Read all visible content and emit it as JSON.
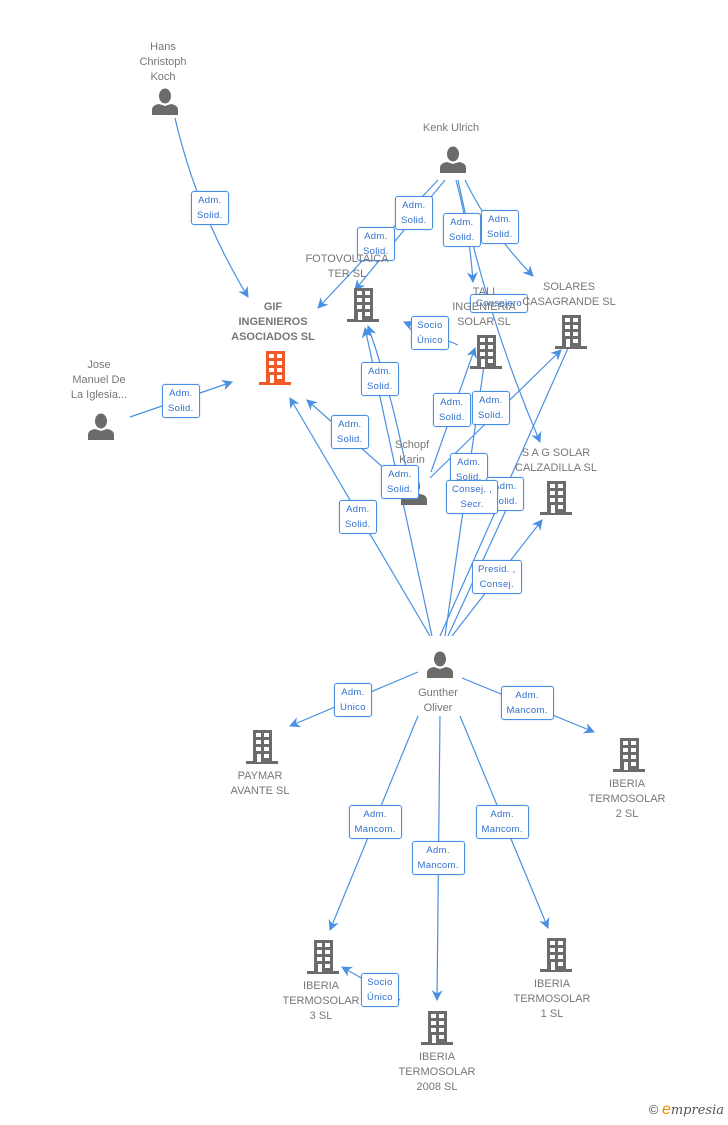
{
  "colors": {
    "edge": "#4a90e2",
    "edge_label_text": "#2f6fcf",
    "icon": "#6b6b6b",
    "focus_icon": "#f05a28",
    "node_text": "#777777"
  },
  "nodes": [
    {
      "id": "hans",
      "type": "person",
      "label": "Hans\nChristoph\nKoch",
      "icon": "person-icon"
    },
    {
      "id": "kenk",
      "type": "person",
      "label": "Kenk Ulrich",
      "icon": "person-icon"
    },
    {
      "id": "gif",
      "type": "company",
      "label": "GIF\nINGENIEROS\nASOCIADOS SL",
      "focus": true,
      "icon": "building-icon"
    },
    {
      "id": "jose",
      "type": "person",
      "label": "Jose\nManuel De\nLa Iglesia...",
      "icon": "person-icon"
    },
    {
      "id": "fotov",
      "type": "company",
      "label": "FOTOVOLTAICA\nTER SL",
      "icon": "building-icon"
    },
    {
      "id": "tali",
      "type": "company",
      "label": "TALI\nINGENIERIA\nSOLAR SL",
      "icon": "building-icon"
    },
    {
      "id": "solares",
      "type": "company",
      "label": "SOLARES\nCASAGRANDE SL",
      "icon": "building-icon"
    },
    {
      "id": "schopf",
      "type": "person",
      "label": "Schopf\nKarin",
      "icon": "person-icon"
    },
    {
      "id": "sag",
      "type": "company",
      "label": "S A G SOLAR\nCALZADILLA  SL",
      "icon": "building-icon"
    },
    {
      "id": "gunther",
      "type": "person",
      "label": "Gunther\nOliver",
      "icon": "person-icon"
    },
    {
      "id": "paymar",
      "type": "company",
      "label": "PAYMAR\nAVANTE SL",
      "icon": "building-icon"
    },
    {
      "id": "iberia2",
      "type": "company",
      "label": "IBERIA\nTERMOSOLAR\n2 SL",
      "icon": "building-icon"
    },
    {
      "id": "iberia3",
      "type": "company",
      "label": "IBERIA\nTERMOSOLAR\n3 SL",
      "icon": "building-icon"
    },
    {
      "id": "iberia2008",
      "type": "company",
      "label": "IBERIA\nTERMOSOLAR\n2008 SL",
      "icon": "building-icon"
    },
    {
      "id": "iberia1",
      "type": "company",
      "label": "IBERIA\nTERMOSOLAR\n1 SL",
      "icon": "building-icon"
    }
  ],
  "edges": [
    {
      "from": "hans",
      "to": "gif",
      "label": "Adm.\nSolid."
    },
    {
      "from": "jose",
      "to": "gif",
      "label": "Adm.\nSolid."
    },
    {
      "from": "kenk",
      "to": "gif",
      "label": "Adm.\nSolid."
    },
    {
      "from": "kenk",
      "to": "fotov",
      "label": "Adm.\nSolid."
    },
    {
      "from": "kenk",
      "to": "tali",
      "label": "Adm.\nSolid."
    },
    {
      "from": "kenk",
      "to": "solares",
      "label": "Adm.\nSolid."
    },
    {
      "from": "kenk",
      "to": "sag",
      "label": "Consejero"
    },
    {
      "from": "tali",
      "to": "fotov",
      "label": "Socio\nÚnico"
    },
    {
      "from": "schopf",
      "to": "fotov",
      "label": "Adm.\nSolid."
    },
    {
      "from": "schopf",
      "to": "gif",
      "label": "Adm.\nSolid."
    },
    {
      "from": "schopf",
      "to": "tali",
      "label": "Adm.\nSolid."
    },
    {
      "from": "schopf",
      "to": "solares",
      "label": "Adm.\nSolid."
    },
    {
      "from": "gunther",
      "to": "fotov",
      "label": "Adm.\nSolid."
    },
    {
      "from": "gunther",
      "to": "gif",
      "label": "Adm.\nSolid."
    },
    {
      "from": "gunther",
      "to": "tali",
      "label": "Adm.\nSolid."
    },
    {
      "from": "gunther",
      "to": "sag",
      "label": "Adm.\nSolid."
    },
    {
      "from": "gunther",
      "to": "solares",
      "label": "Consej. ,\nSecr."
    },
    {
      "from": "gunther",
      "to": "sag",
      "label": "Presid. ,\nConsej."
    },
    {
      "from": "gunther",
      "to": "paymar",
      "label": "Adm.\nUnico"
    },
    {
      "from": "gunther",
      "to": "iberia2",
      "label": "Adm.\nMancom."
    },
    {
      "from": "gunther",
      "to": "iberia3",
      "label": "Adm.\nMancom."
    },
    {
      "from": "gunther",
      "to": "iberia2008",
      "label": "Adm.\nMancom."
    },
    {
      "from": "gunther",
      "to": "iberia1",
      "label": "Adm.\nMancom."
    },
    {
      "from": "iberia2008",
      "to": "iberia3",
      "label": "Socio\nÚnico"
    }
  ],
  "footer": {
    "copyright_symbol": "©",
    "brand_initial": "e",
    "brand_rest": "mpresia"
  }
}
